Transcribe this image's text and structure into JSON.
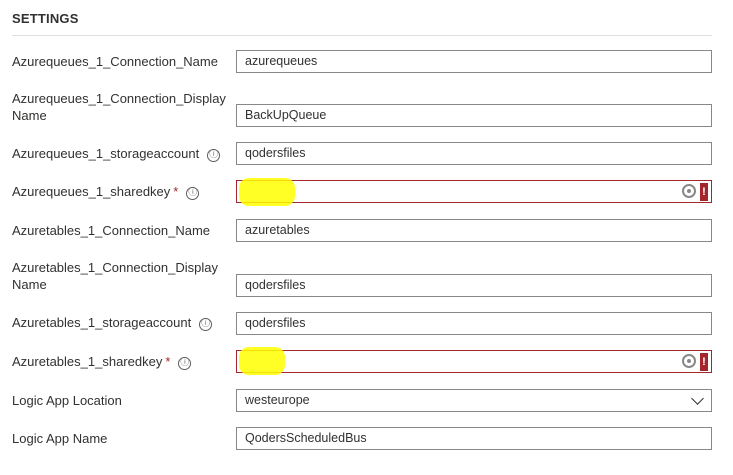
{
  "section": {
    "title": "SETTINGS"
  },
  "fields": [
    {
      "label": "Azurequeues_1_Connection_Name",
      "value": "azurequeues"
    },
    {
      "label": "Azurequeues_1_Connection_Display Name",
      "value": "BackUpQueue"
    },
    {
      "label": "Azurequeues_1_storageaccount",
      "value": "qodersfiles",
      "info": "ⓘ"
    },
    {
      "label": "Azurequeues_1_sharedkey",
      "value": "",
      "required": "*",
      "info": "ⓘ",
      "error_icon": "!"
    },
    {
      "label": "Azuretables_1_Connection_Name",
      "value": "azuretables"
    },
    {
      "label": "Azuretables_1_Connection_Display Name",
      "value": "qodersfiles"
    },
    {
      "label": "Azuretables_1_storageaccount",
      "value": "qodersfiles",
      "info": "ⓘ"
    },
    {
      "label": "Azuretables_1_sharedkey",
      "value": "",
      "required": "*",
      "info": "ⓘ",
      "error_icon": "!"
    },
    {
      "label": "Logic App Location",
      "value": "westeurope"
    },
    {
      "label": "Logic App Name",
      "value": "QodersScheduledBus"
    }
  ],
  "colors": {
    "error_border": "#a4262c",
    "highlight": "#ffff00",
    "input_border": "#8a8886"
  },
  "icons": {
    "info": "info-icon",
    "password_reveal": "key-icon",
    "error": "error-icon",
    "dropdown": "chevron-down-icon"
  }
}
